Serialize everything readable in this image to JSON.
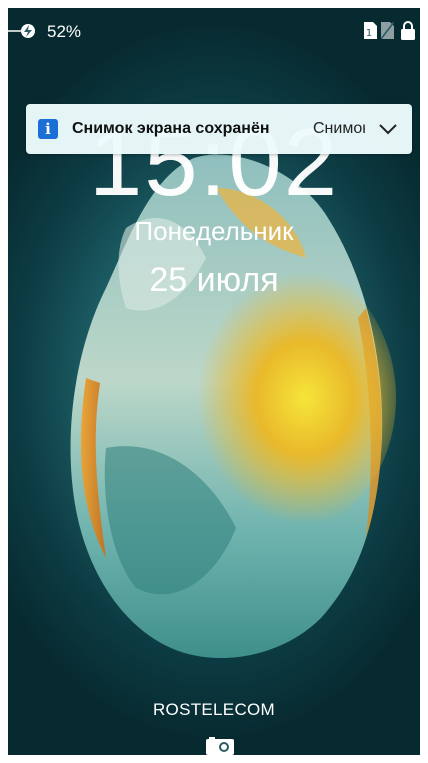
{
  "status_bar": {
    "battery_percent": "52%",
    "charging": true,
    "icons": [
      "charge-icon",
      "sim1-icon",
      "sim2-icon",
      "lock-icon"
    ]
  },
  "notification": {
    "icon": "info-icon",
    "icon_glyph": "i",
    "title": "Снимок экрана сохранён",
    "preview": "Снимок",
    "expand_icon": "chevron-down-icon"
  },
  "lockscreen": {
    "time": "15:02",
    "weekday": "Понедельник",
    "date": "25 июля"
  },
  "carrier": "ROSTELECOM",
  "camera_shortcut": "camera-icon",
  "colors": {
    "notification_bg": "#ECFBFC",
    "info_icon": "#1D6FD8",
    "wallpaper_teal": "#1E5F66"
  }
}
